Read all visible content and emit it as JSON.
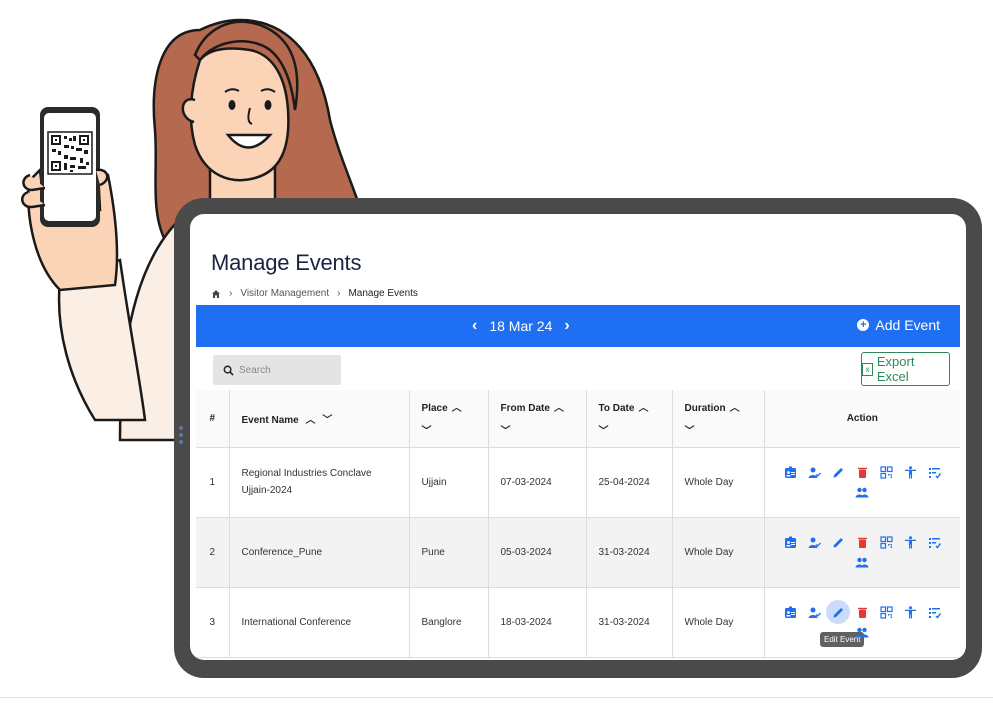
{
  "page": {
    "title": "Manage Events",
    "breadcrumb": [
      "Visitor Management",
      "Manage Events"
    ]
  },
  "date_bar": {
    "current_date": "18 Mar 24",
    "add_event_label": "Add Event",
    "bg_color": "#1e6ff2"
  },
  "search": {
    "placeholder": "Search"
  },
  "export": {
    "label": "Export Excel",
    "color": "#2e8b57"
  },
  "table": {
    "headers": {
      "num": "#",
      "event_name": "Event Name",
      "place": "Place",
      "from_date": "From Date",
      "to_date": "To Date",
      "duration": "Duration",
      "action": "Action"
    },
    "rows": [
      {
        "num": "1",
        "event_name": "Regional Industries Conclave Ujjain-2024",
        "place": "Ujjain",
        "from_date": "07-03-2024",
        "to_date": "25-04-2024",
        "duration": "Whole Day"
      },
      {
        "num": "2",
        "event_name": "Conference_Pune",
        "place": "Pune",
        "from_date": "05-03-2024",
        "to_date": "31-03-2024",
        "duration": "Whole Day"
      },
      {
        "num": "3",
        "event_name": "International Conference",
        "place": "Banglore",
        "from_date": "18-03-2024",
        "to_date": "31-03-2024",
        "duration": "Whole Day"
      }
    ],
    "action_icons": [
      "id-badge-icon",
      "user-check-icon",
      "edit-icon",
      "delete-icon",
      "qr-code-icon",
      "person-icon",
      "checklist-icon",
      "group-icon"
    ]
  },
  "tooltip": {
    "text": "Edit Event"
  }
}
